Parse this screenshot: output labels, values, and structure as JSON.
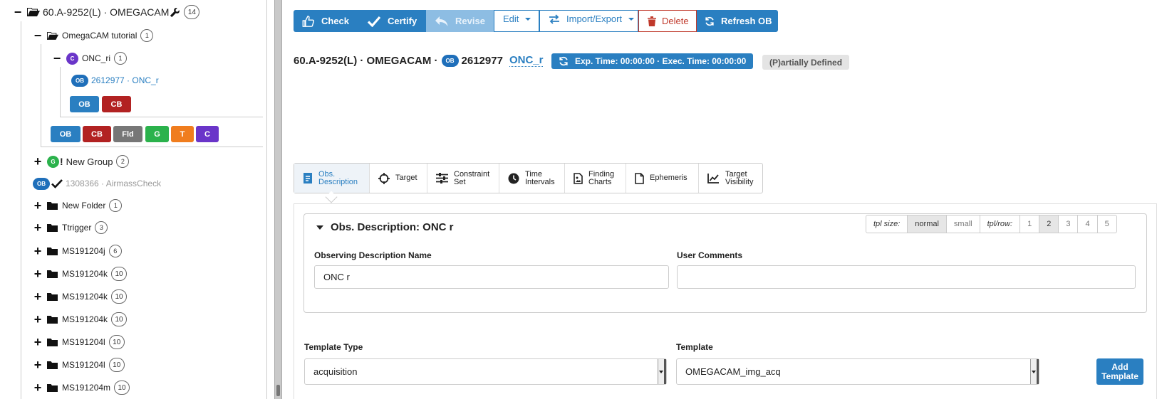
{
  "tree": {
    "root": {
      "label": "60.A-9252(L) · OMEGACAM",
      "count": "14"
    },
    "tutorial": {
      "label": "OmegaCAM tutorial",
      "count": "1"
    },
    "onc_ri": {
      "badge": "C",
      "label": "ONC_ri",
      "count": "1"
    },
    "ob_item": {
      "badge": "OB",
      "label": "2612977 · ONC_r"
    },
    "inner_buttons": [
      "OB",
      "CB"
    ],
    "outer_buttons": [
      "OB",
      "CB",
      "Fld",
      "G",
      "T",
      "C"
    ],
    "new_group": {
      "badge": "G",
      "mark": "!",
      "label": "New Group",
      "count": "2"
    },
    "airmass": {
      "badge": "OB",
      "label": "1308366 · AirmassCheck"
    },
    "folders": [
      {
        "label": "New Folder",
        "count": "1"
      },
      {
        "label": "Ttrigger",
        "count": "3"
      },
      {
        "label": "MS191204j",
        "count": "6"
      },
      {
        "label": "MS191204k",
        "count": "10"
      },
      {
        "label": "MS191204k",
        "count": "10"
      },
      {
        "label": "MS191204k",
        "count": "10"
      },
      {
        "label": "MS191204l",
        "count": "10"
      },
      {
        "label": "MS191204l",
        "count": "10"
      },
      {
        "label": "MS191204m",
        "count": "10"
      }
    ]
  },
  "toolbar": {
    "check": "Check",
    "certify": "Certify",
    "revise": "Revise",
    "edit": "Edit",
    "import_export": "Import/Export",
    "delete": "Delete",
    "refresh": "Refresh OB"
  },
  "header": {
    "run": "60.A-9252(L) · OMEGACAM ·",
    "ob_badge": "OB",
    "ob_id": "2612977",
    "ob_name": "ONC_r",
    "exp_time": "Exp. Time: 00:00:00 · Exec. Time: 00:00:00",
    "status": "(P)artially Defined"
  },
  "tabs": [
    {
      "l1": "Obs.",
      "l2": "Description"
    },
    {
      "l1": "Target",
      "l2": ""
    },
    {
      "l1": "Constraint",
      "l2": "Set"
    },
    {
      "l1": "Time",
      "l2": "Intervals"
    },
    {
      "l1": "Finding",
      "l2": "Charts"
    },
    {
      "l1": "Ephemeris",
      "l2": ""
    },
    {
      "l1": "Target",
      "l2": "Visibility"
    }
  ],
  "obs_description": {
    "title": "Obs. Description: ONC r",
    "tpl_size_label": "tpl size:",
    "tpl_size_options": [
      "normal",
      "small"
    ],
    "tpl_row_label": "tpl/row:",
    "tpl_row_options": [
      "1",
      "2",
      "3",
      "4",
      "5"
    ],
    "name_label": "Observing Description Name",
    "name_value": "ONC r",
    "comments_label": "User Comments",
    "comments_value": ""
  },
  "template": {
    "type_label": "Template Type",
    "type_value": "acquisition",
    "template_label": "Template",
    "template_value": "OMEGACAM_img_acq",
    "add_button": "Add Template"
  }
}
